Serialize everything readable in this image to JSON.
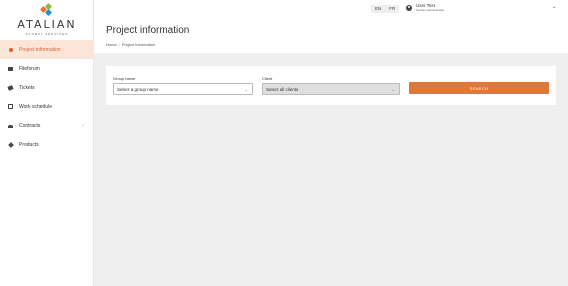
{
  "brand": {
    "name": "ATALIAN",
    "tagline": "GLOBAL SERVICES"
  },
  "sidebar": {
    "items": [
      {
        "label": "Project information",
        "icon": "dot-icon",
        "active": true
      },
      {
        "label": "Fileforum",
        "icon": "folder-icon"
      },
      {
        "label": "Tickets",
        "icon": "ticket-icon"
      },
      {
        "label": "Work schedule",
        "icon": "calendar-icon"
      },
      {
        "label": "Contracts",
        "icon": "people-icon",
        "chevron": "›"
      },
      {
        "label": "Products",
        "icon": "tag-icon"
      }
    ]
  },
  "header": {
    "languages": [
      "EN",
      "FR"
    ],
    "user": {
      "name": "User Test",
      "role": "System Administrator"
    },
    "user_caret": "⌄"
  },
  "page": {
    "title": "Project information",
    "breadcrumb": [
      "Home",
      "Project information"
    ],
    "breadcrumb_separator": "/"
  },
  "filters": {
    "group": {
      "label": "Group name",
      "value": "Select a group name",
      "caret": "⌄"
    },
    "client": {
      "label": "Client",
      "value": "Select all clients",
      "caret": "⌄"
    },
    "search_label": "SEARCH"
  },
  "colors": {
    "accent": "#e0783a",
    "active_bg": "#fbe5d9",
    "background": "#efefef"
  }
}
